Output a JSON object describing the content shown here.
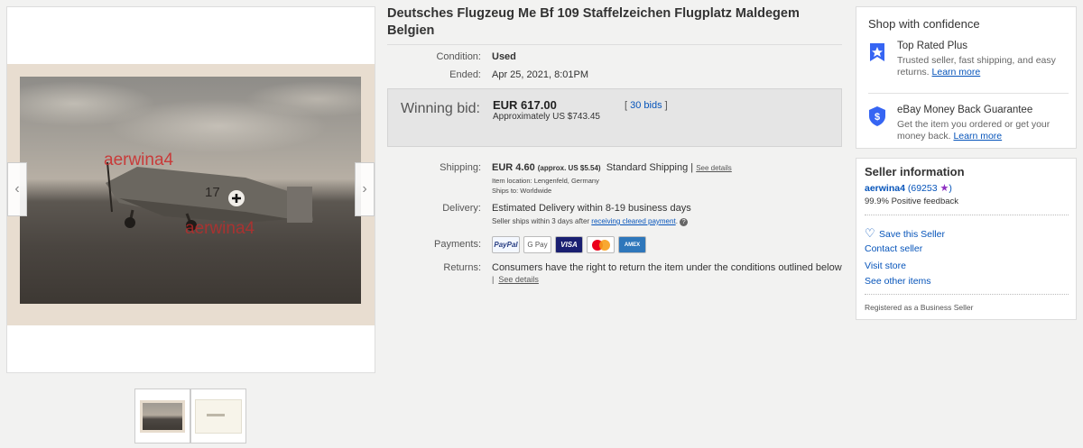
{
  "listing": {
    "title": "Deutsches Flugzeug Me Bf 109 Staffelzeichen Flugplatz Maldegem Belgien",
    "watermark": "aerwina4",
    "condition_label": "Condition:",
    "condition_value": "Used",
    "ended_label": "Ended:",
    "ended_value": "Apr 25, 2021, 8:01PM",
    "winning_bid_label": "Winning bid:",
    "winning_bid_value": "EUR 617.00",
    "approx_value": "Approximately US $743.45",
    "bids_open": "[ ",
    "bids_link": "30 bids",
    "bids_close": " ]",
    "shipping_label": "Shipping:",
    "shipping_cost": "EUR 4.60",
    "shipping_approx": "(approx. US $5.54)",
    "shipping_method": "Standard Shipping |",
    "see_details": "See details",
    "item_location": "Item location:  Lengenfeld, Germany",
    "ships_to": "Ships to:  Worldwide",
    "delivery_label": "Delivery:",
    "delivery_value": "Estimated Delivery within 8-19 business days",
    "delivery_note": "Seller ships within 3 days after",
    "delivery_link": "receiving cleared payment",
    "payments_label": "Payments:",
    "payment_methods": [
      "PayPal",
      "G Pay",
      "VISA",
      "",
      "AMEX"
    ],
    "returns_label": "Returns:",
    "returns_value": "Consumers have the right to return the item under the conditions outlined below",
    "returns_link": "See details"
  },
  "confidence": {
    "title": "Shop with confidence",
    "items": [
      {
        "heading": "Top Rated Plus",
        "desc": "Trusted seller, fast shipping, and easy returns.",
        "link": "Learn more"
      },
      {
        "heading": "eBay Money Back Guarantee",
        "desc": "Get the item you ordered or get your money back.",
        "link": "Learn more"
      }
    ]
  },
  "seller": {
    "title": "Seller information",
    "name": "aerwina4",
    "score": "(69253",
    "score_close": ")",
    "feedback": "99.9% Positive feedback",
    "save": "Save this Seller",
    "contact": "Contact seller",
    "store": "Visit store",
    "other": "See other items",
    "registered": "Registered as a Business Seller"
  },
  "colors": {
    "link": "#0654ba",
    "star": "#8e2fc1"
  }
}
